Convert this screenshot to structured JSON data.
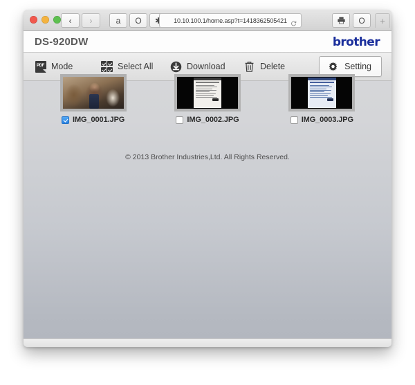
{
  "browser": {
    "traffic_lights": [
      "close",
      "minimize",
      "zoom"
    ],
    "nav": {
      "back": "‹",
      "forward": "›",
      "amazon": "a",
      "opera": "O",
      "asterisk": "✱"
    },
    "address": {
      "url": "10.10.100.1/home.asp?t=1418362505421",
      "reload_label": "↻"
    },
    "right_icons": {
      "print": "print-icon",
      "opera": "O"
    },
    "new_tab_label": "+"
  },
  "page": {
    "header": {
      "device_model": "DS-920DW",
      "brand": "brother"
    },
    "toolbar": {
      "items": [
        {
          "label": "Mode",
          "icon": "pdf-icon",
          "badge": "PDF"
        },
        {
          "label": "Select All",
          "icon": "select-all-icon"
        },
        {
          "label": "Download",
          "icon": "download-icon"
        },
        {
          "label": "Delete",
          "icon": "trash-icon"
        }
      ],
      "setting": {
        "label": "Setting",
        "icon": "gear-icon"
      }
    },
    "files": [
      {
        "name": "IMG_0001.JPG",
        "selected": true,
        "kind": "photo"
      },
      {
        "name": "IMG_0002.JPG",
        "selected": false,
        "kind": "document"
      },
      {
        "name": "IMG_0003.JPG",
        "selected": false,
        "kind": "document-blue"
      }
    ],
    "footer": "© 2013 Brother Industries,Ltd. All Rights Reserved."
  },
  "colors": {
    "brand_blue": "#1b2f9c",
    "checkbox_checked": "#2b82e0",
    "page_bg_top": "#d7d8da",
    "page_bg_bottom": "#b2b6be",
    "toolbar_top": "#efefef",
    "toolbar_bottom": "#dddddd"
  }
}
